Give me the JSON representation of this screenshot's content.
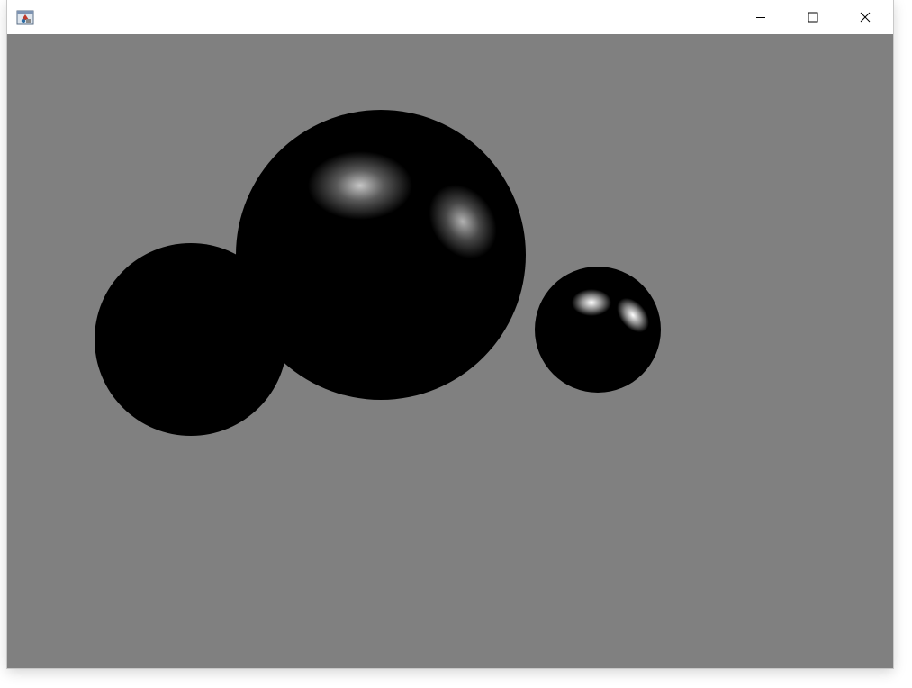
{
  "window": {
    "title": "",
    "icon": "java-app-icon",
    "controls": {
      "minimize_icon": "minimize-icon",
      "maximize_icon": "maximize-icon",
      "close_icon": "close-icon"
    }
  },
  "scene": {
    "background_color": "#808080",
    "sphere_color": "#000000",
    "highlight_color": "#ffffff",
    "spheres": [
      {
        "name": "left-unlit-sphere",
        "lit": false
      },
      {
        "name": "large-center-sphere",
        "lit": true
      },
      {
        "name": "small-right-sphere",
        "lit": true
      }
    ]
  }
}
